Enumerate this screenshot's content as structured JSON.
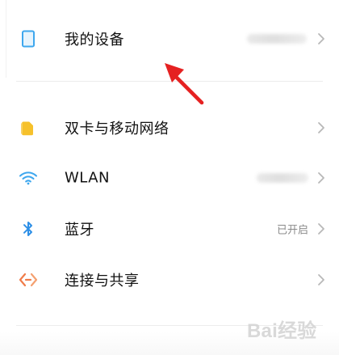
{
  "settings": {
    "rows": [
      {
        "icon": "phone-device-icon",
        "label": "我的设备",
        "value": ""
      },
      {
        "icon": "sim-card-icon",
        "label": "双卡与移动网络",
        "value": ""
      },
      {
        "icon": "wifi-icon",
        "label": "WLAN",
        "value": ""
      },
      {
        "icon": "bluetooth-icon",
        "label": "蓝牙",
        "value": "已开启"
      },
      {
        "icon": "connection-share-icon",
        "label": "连接与共享",
        "value": ""
      }
    ]
  },
  "watermark": {
    "text": "Bai经验"
  },
  "colors": {
    "accent_blue": "#3ea7ee",
    "bluetooth_blue": "#2e8fe6",
    "sim_yellow": "#f6c12b",
    "share_orange": "#f07c4a",
    "arrow_red": "#e52121"
  }
}
